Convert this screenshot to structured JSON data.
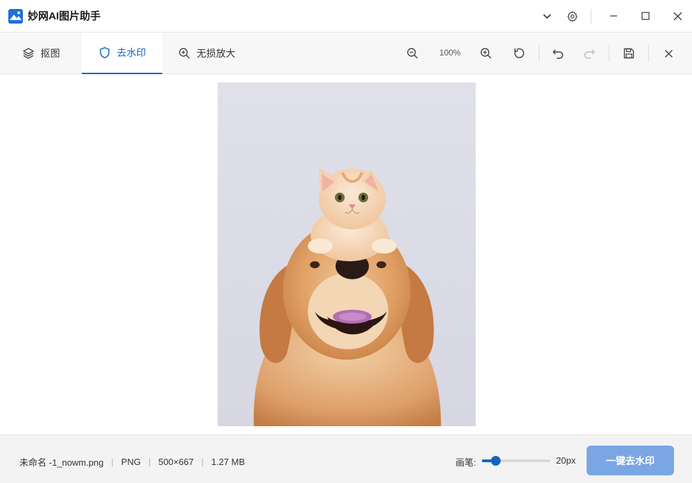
{
  "app": {
    "title": "妙网AI图片助手"
  },
  "titlebar": {
    "icons": [
      "chevron-down-icon",
      "gear-icon",
      "minimize-icon",
      "maximize-icon",
      "close-icon"
    ]
  },
  "tabs": [
    {
      "label": "抠图",
      "icon": "layers-icon",
      "active": false
    },
    {
      "label": "去水印",
      "icon": "shield-icon",
      "active": true
    },
    {
      "label": "无损放大",
      "icon": "zoom-in-icon",
      "active": false
    }
  ],
  "toolbar": {
    "zoom_level": "100%",
    "tools": [
      "zoom-out-icon",
      "zoom-in-icon",
      "reset-icon",
      "undo-icon",
      "redo-icon",
      "save-icon",
      "close-icon"
    ]
  },
  "status": {
    "file_name": "未命名 -1_nowm.png",
    "file_format": "PNG",
    "dimensions": "500×667",
    "file_size": "1.27 MB",
    "brush_label": "画笔:",
    "brush_value": "20px",
    "brush_level": 0.2,
    "action_button": "一键去水印"
  },
  "colors": {
    "accent": "#1565c0",
    "primary_button": "#7ba6e4",
    "photo_background": "#dcdde8"
  }
}
